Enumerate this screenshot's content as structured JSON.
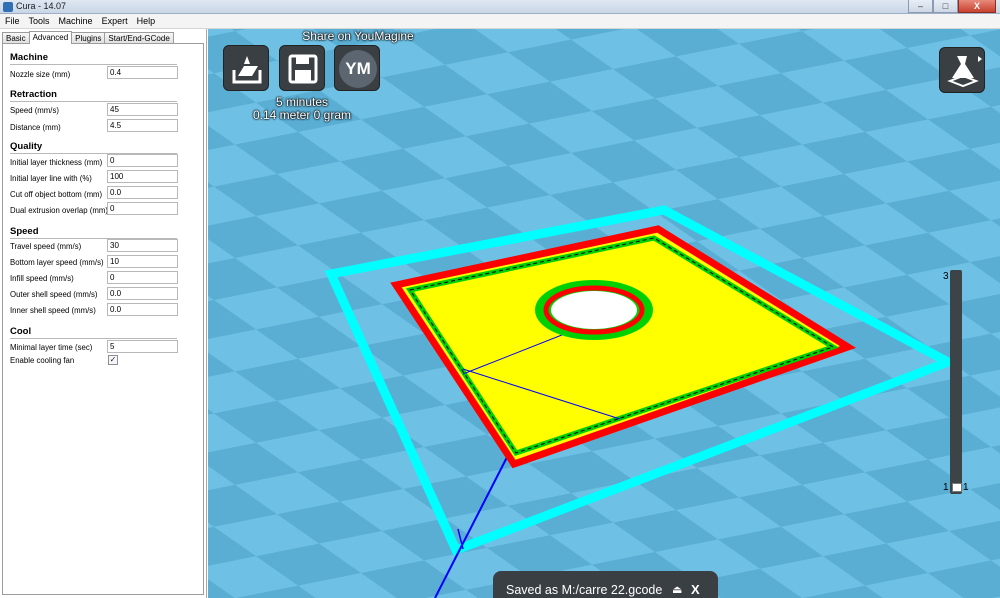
{
  "window": {
    "title": "Cura - 14.07",
    "minimize": "–",
    "maximize": "□",
    "close": "X"
  },
  "menu": [
    "File",
    "Tools",
    "Machine",
    "Expert",
    "Help"
  ],
  "tabs": [
    "Basic",
    "Advanced",
    "Plugins",
    "Start/End-GCode"
  ],
  "active_tab": "Advanced",
  "sections": {
    "machine": {
      "title": "Machine",
      "nozzle_label": "Nozzle size (mm)",
      "nozzle_value": "0.4"
    },
    "retraction": {
      "title": "Retraction",
      "speed_label": "Speed (mm/s)",
      "speed_value": "45",
      "distance_label": "Distance (mm)",
      "distance_value": "4.5"
    },
    "quality": {
      "title": "Quality",
      "initial_thickness_label": "Initial layer thickness (mm)",
      "initial_thickness_value": "0",
      "initial_width_label": "Initial layer line with (%)",
      "initial_width_value": "100",
      "cutoff_label": "Cut off object bottom (mm)",
      "cutoff_value": "0.0",
      "dual_overlap_label": "Dual extrusion overlap (mm)",
      "dual_overlap_value": "0"
    },
    "speed": {
      "title": "Speed",
      "travel_label": "Travel speed (mm/s)",
      "travel_value": "30",
      "bottom_label": "Bottom layer speed (mm/s)",
      "bottom_value": "10",
      "infill_label": "Infill speed (mm/s)",
      "infill_value": "0",
      "outer_label": "Outer shell speed (mm/s)",
      "outer_value": "0.0",
      "inner_label": "Inner shell speed (mm/s)",
      "inner_value": "0.0"
    },
    "cool": {
      "title": "Cool",
      "min_layer_label": "Minimal layer time (sec)",
      "min_layer_value": "5",
      "fan_label": "Enable cooling fan",
      "fan_checked": "✓"
    }
  },
  "viewport": {
    "share_text": "Share on YouMagine",
    "ym_label": "YM",
    "print_time": "5 minutes",
    "print_material": "0.14 meter 0 gram",
    "layer_top": "3",
    "layer_bottom_left": "1",
    "layer_bottom_right": "1",
    "toast_text": "Saved as M:/carre 22.gcode",
    "toast_eject": "⏏",
    "toast_close": "X"
  },
  "colors": {
    "floor_light": "#6ec0e4",
    "floor_dark": "#5aaed4",
    "build_outline": "#00ffff",
    "perimeter": "#ff0000",
    "inner_wall": "#00d000",
    "infill": "#ffff00",
    "travel": "#0000ff",
    "toolbar_button": "#3a3f44"
  },
  "icons": [
    "load-model-icon",
    "save-gcode-icon",
    "youmagine-icon",
    "view-mode-icon"
  ]
}
